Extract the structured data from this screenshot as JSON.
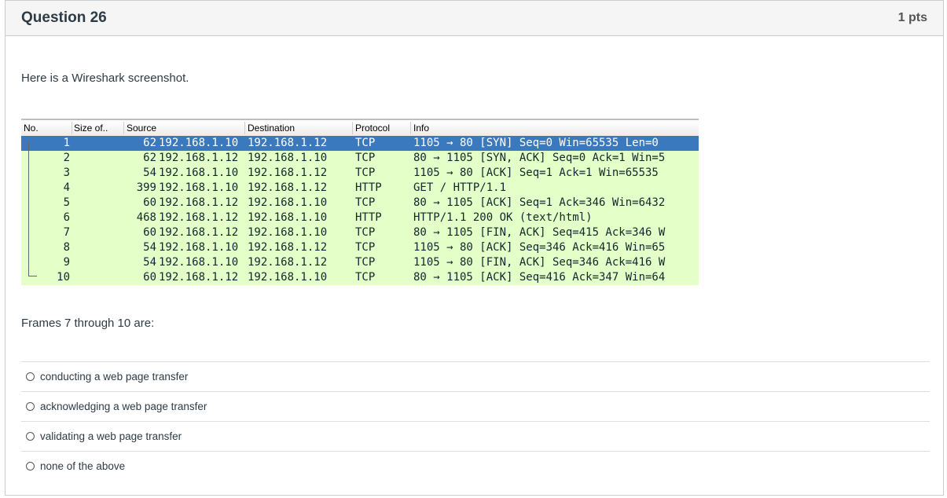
{
  "question": {
    "title": "Question 26",
    "points": "1 pts",
    "intro": "Here is a Wireshark screenshot.",
    "prompt": "Frames 7 through 10 are:"
  },
  "wireshark": {
    "columns": [
      "No.",
      "Size of..",
      "Source",
      "Destination",
      "Protocol",
      "Info"
    ],
    "rows": [
      {
        "no": "1",
        "size": "62",
        "src": "192.168.1.10",
        "dst": "192.168.1.12",
        "proto": "TCP",
        "info": "1105 → 80 [SYN] Seq=0 Win=65535 Len=0",
        "selected": true
      },
      {
        "no": "2",
        "size": "62",
        "src": "192.168.1.12",
        "dst": "192.168.1.10",
        "proto": "TCP",
        "info": "80 → 1105 [SYN, ACK] Seq=0 Ack=1 Win=5"
      },
      {
        "no": "3",
        "size": "54",
        "src": "192.168.1.10",
        "dst": "192.168.1.12",
        "proto": "TCP",
        "info": "1105 → 80 [ACK] Seq=1 Ack=1 Win=65535"
      },
      {
        "no": "4",
        "size": "399",
        "src": "192.168.1.10",
        "dst": "192.168.1.12",
        "proto": "HTTP",
        "info": "GET / HTTP/1.1"
      },
      {
        "no": "5",
        "size": "60",
        "src": "192.168.1.12",
        "dst": "192.168.1.10",
        "proto": "TCP",
        "info": "80 → 1105 [ACK] Seq=1 Ack=346 Win=6432"
      },
      {
        "no": "6",
        "size": "468",
        "src": "192.168.1.12",
        "dst": "192.168.1.10",
        "proto": "HTTP",
        "info": "HTTP/1.1 200 OK  (text/html)"
      },
      {
        "no": "7",
        "size": "60",
        "src": "192.168.1.12",
        "dst": "192.168.1.10",
        "proto": "TCP",
        "info": "80 → 1105 [FIN, ACK] Seq=415 Ack=346 W"
      },
      {
        "no": "8",
        "size": "54",
        "src": "192.168.1.10",
        "dst": "192.168.1.12",
        "proto": "TCP",
        "info": "1105 → 80 [ACK] Seq=346 Ack=416 Win=65"
      },
      {
        "no": "9",
        "size": "54",
        "src": "192.168.1.10",
        "dst": "192.168.1.12",
        "proto": "TCP",
        "info": "1105 → 80 [FIN, ACK] Seq=346 Ack=416 W"
      },
      {
        "no": "10",
        "size": "60",
        "src": "192.168.1.12",
        "dst": "192.168.1.10",
        "proto": "TCP",
        "info": "80 → 1105 [ACK] Seq=416 Ack=347 Win=64"
      }
    ],
    "colors": {
      "selected": "#3a79bd",
      "tcp_row": "#e4ffc7"
    }
  },
  "answers": [
    "conducting a web page transfer",
    "acknowledging a web page transfer",
    "validating a web page transfer",
    "none of the above"
  ]
}
